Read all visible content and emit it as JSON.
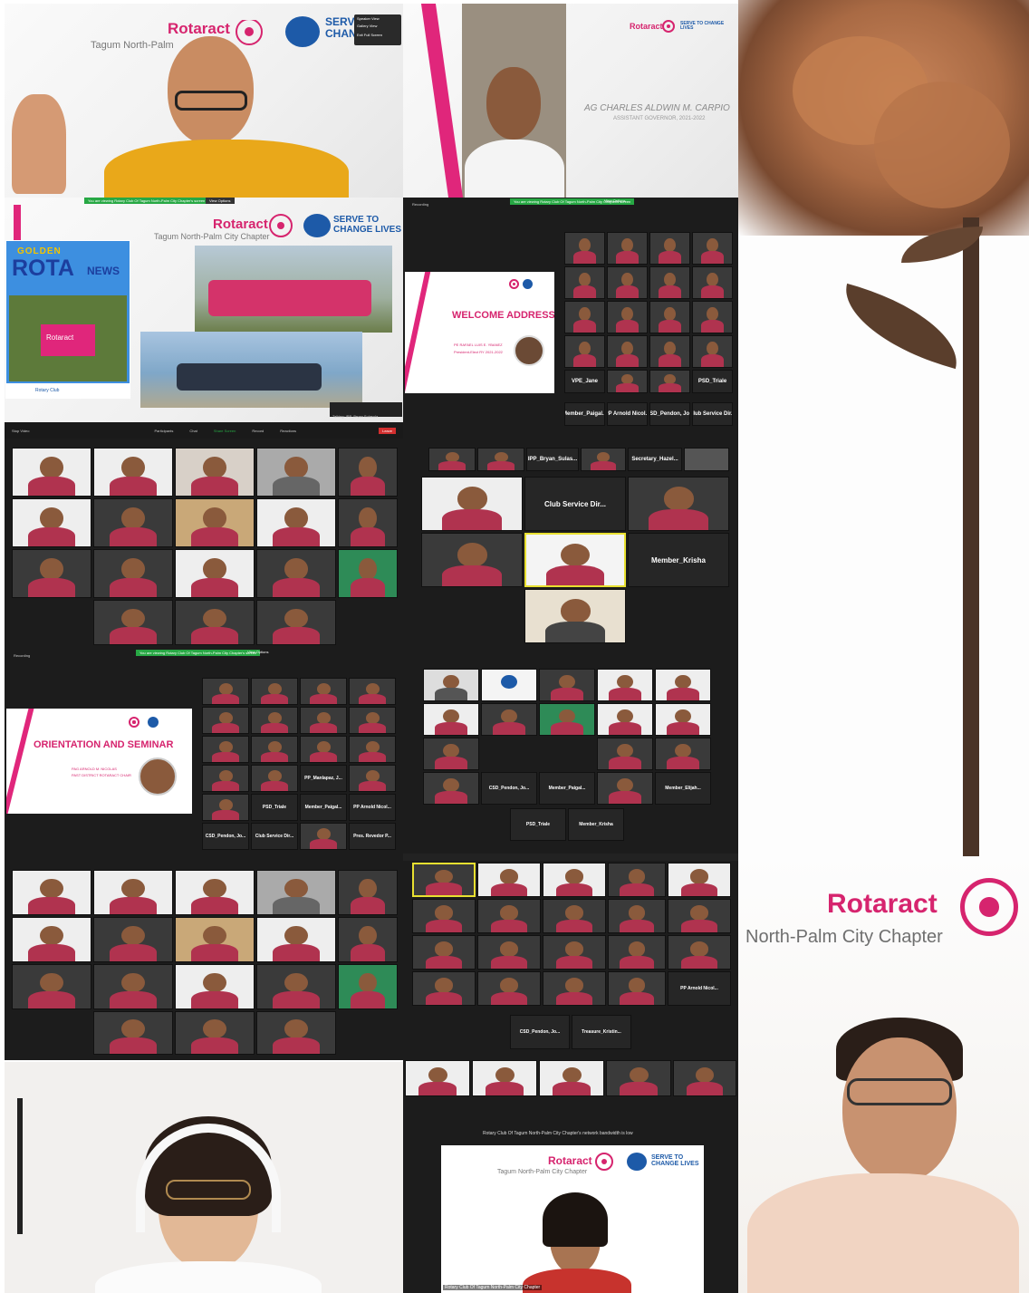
{
  "panel1": {
    "brand": "Rotaract",
    "chapter": "Tagum North-Palm",
    "serve": "SERV",
    "change": "CHAN",
    "menu": [
      "Speaker View",
      "Gallery View",
      "Exit Full Screen"
    ]
  },
  "panel2": {
    "brand": "Rotaract",
    "serve": "SERVE TO CHANGE LIVES",
    "name": "AG CHARLES ALDWIN M. CARPIO",
    "role": "ASSISTANT GOVERNOR, 2021-2022"
  },
  "panel3": {
    "greenbar": "You are viewing Rotary Club Of Tagum North-Palm City Chapter's screen",
    "view_options": "View Options",
    "brand": "Rotaract",
    "chapter": "Tagum North-Palm City Chapter",
    "serve": "SERVE TO",
    "change": "CHANGE LIVES",
    "news_golden": "GOLDEN",
    "news_rota": "ROTA",
    "news_news": "NEWS",
    "news_rotaract": "Rotaract",
    "talking": "Talking: IPP_Bryan Sulasula",
    "toolbar": [
      "Stop Video",
      "Participants",
      "Chat",
      "Share Screen",
      "Record",
      "Reactions",
      "Leave"
    ],
    "rotary_tag": "Rotary Club"
  },
  "panel4": {
    "recording": "Recording",
    "greenbar": "You are viewing Rotary Club Of Tagum North-Palm City Chapter's screen",
    "view_options": "View Options",
    "title": "WELCOME ADDRESS",
    "speaker": "PE RAFAEL LUIS E. YBANEZ",
    "speaker_role": "President-Elect RY 2021-2022",
    "name_tiles": [
      "VPE_Jane",
      "PSD_Triale",
      "Member_Paigal...",
      "PP Arnold Nicol...",
      "CSD_Pendon, Jo...",
      "Club Service Dir..."
    ]
  },
  "panel6": {
    "names": [
      "IPP_Bryan_Sulas...",
      "Secretary_Hazel...",
      "Club Service Dir...",
      "Member_Krisha"
    ]
  },
  "panel7": {
    "recording": "Recording",
    "greenbar": "You are viewing Rotary Club Of Tagum North-Palm City Chapter's screen",
    "view_options": "View Options",
    "title": "ORIENTATION AND SEMINAR",
    "speaker": "PAG ARNOLD M. NICOLAS",
    "speaker_role": "PAST DISTRICT ROTARACT CHAIR",
    "name_tiles": [
      "PP_Manlapaz, J...",
      "PSD_Triale",
      "Member_Paigal...",
      "PP Arnold Nicol...",
      "CSD_Pendon, Jo...",
      "Club Service Dir...",
      "Pres. Revedor P..."
    ]
  },
  "panel8": {
    "names": [
      "CSD_Pendon, Jo...",
      "Member_Paigal...",
      "Member_Elijah...",
      "PSD_Triale",
      "Member_Krisha"
    ]
  },
  "panel10": {
    "names": [
      "PP Arnold Nicol...",
      "CSD_Pendon, Jo...",
      "Treasure_Kristin..."
    ]
  },
  "panel12": {
    "bandwidth": "Rotary Club Of Tagum North-Palm City Chapter's network bandwidth is low",
    "brand": "Rotaract",
    "chapter": "Tagum North-Palm City Chapter",
    "serve": "SERVE TO",
    "change": "CHANGE LIVES",
    "caption": "Rotary Club Of Tagum North-Palm City Chapter"
  },
  "panel13": {
    "brand": "Rotaract",
    "chapter": "North-Palm City Chapter"
  },
  "colors": {
    "brand_pink": "#d6246e",
    "brand_blue": "#1d5aa8",
    "zoom_green": "#27a844",
    "zoom_bg": "#1c1c1c"
  }
}
